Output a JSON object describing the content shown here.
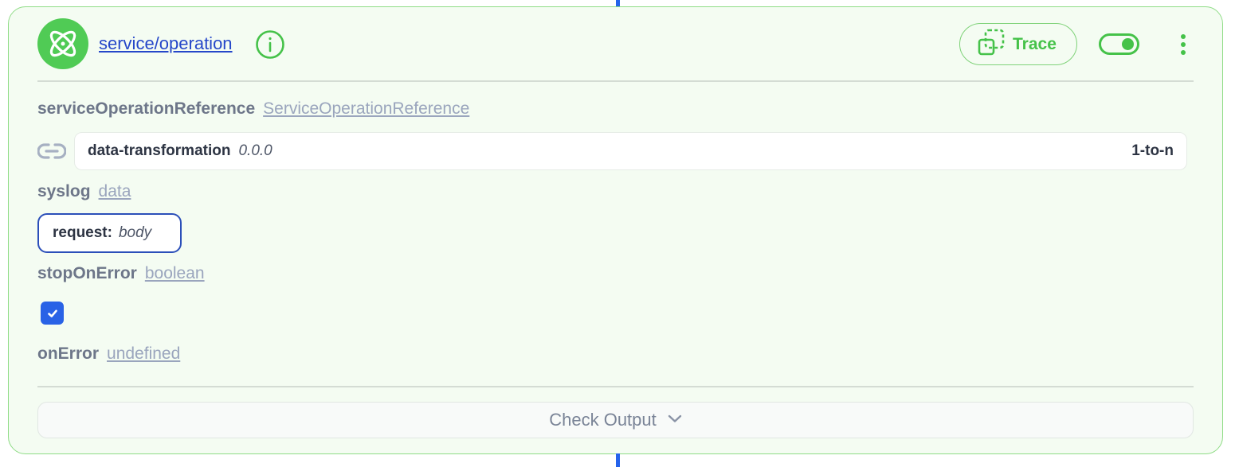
{
  "header": {
    "logo_icon": "atom-icon",
    "title": "service/operation",
    "info_icon": "info-icon",
    "trace_label": "Trace",
    "trace_icon": "trace-frame-icon",
    "toggle_state": "on",
    "menu_icon": "vertical-dots-icon"
  },
  "fields": {
    "service_operation_reference": {
      "name": "serviceOperationReference",
      "type": "ServiceOperationReference",
      "value": {
        "name": "data-transformation",
        "version": "0.0.0",
        "cardinality": "1-to-n"
      }
    },
    "syslog": {
      "name": "syslog",
      "type": "data",
      "value": {
        "key": "request:",
        "val": "body"
      }
    },
    "stop_on_error": {
      "name": "stopOnError",
      "type": "boolean",
      "checked": true
    },
    "on_error": {
      "name": "onError",
      "type": "undefined"
    }
  },
  "footer": {
    "check_output_label": "Check Output"
  },
  "colors": {
    "brand_green": "#45c249",
    "card_bg": "#f4fcf2",
    "card_border": "#8fdc86",
    "link_blue": "#2547c9",
    "connector_blue": "#2563eb",
    "checkbox_blue": "#2962e6"
  }
}
